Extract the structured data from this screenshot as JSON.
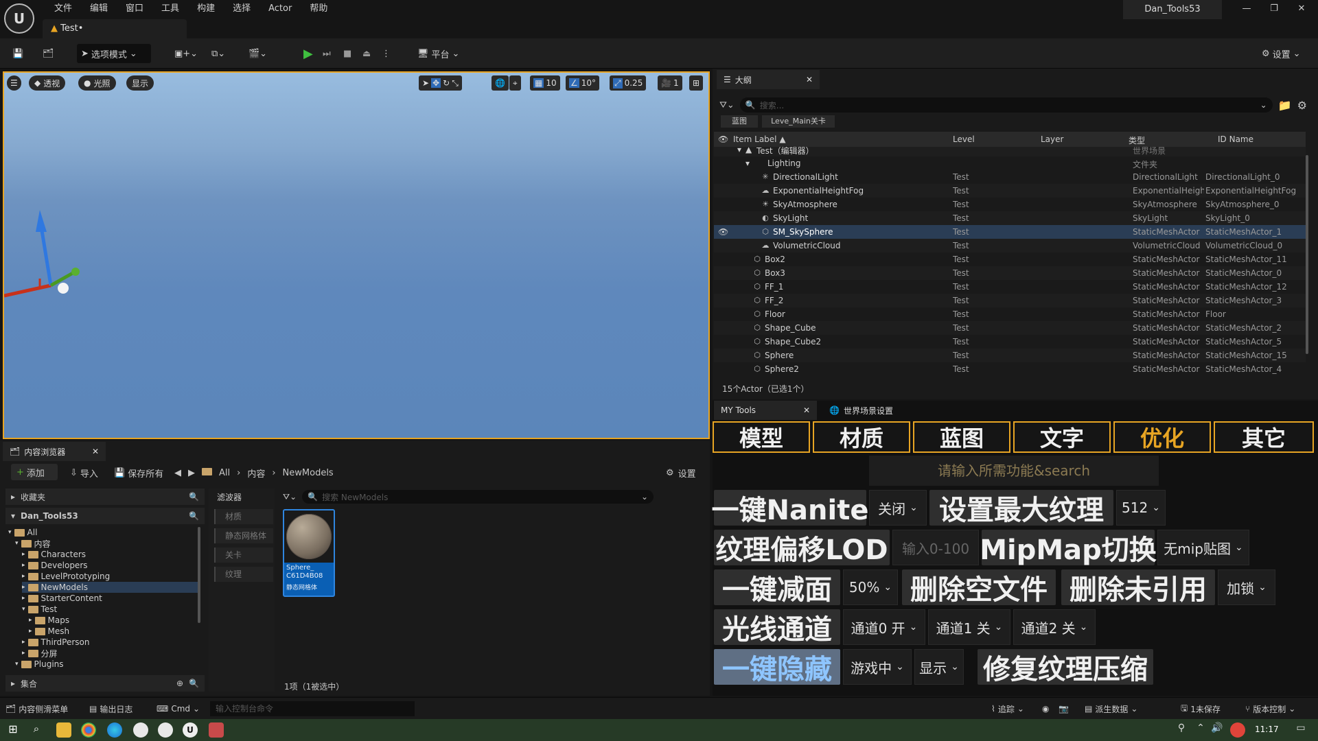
{
  "titlebar": {
    "menu": [
      "文件",
      "编辑",
      "窗口",
      "工具",
      "构建",
      "选择",
      "Actor",
      "帮助"
    ],
    "doc_tab": "Test•",
    "project": "Dan_Tools53"
  },
  "toolbar": {
    "mode": "选项模式",
    "platform": "平台",
    "settings": "设置"
  },
  "viewport": {
    "perspective": "透视",
    "lighting": "光照",
    "show": "显示",
    "grid_snap": "10",
    "rot_snap": "10°",
    "scale_snap": "0.25",
    "camera_speed": "1"
  },
  "outliner": {
    "tab": "大纲",
    "search_placeholder": "搜索...",
    "chips": [
      "蓝图",
      "Leve_Main关卡"
    ],
    "columns": [
      "Item Label ▲",
      "Level",
      "Layer",
      "类型",
      "ID Name"
    ],
    "root": {
      "label": "Test（编辑器）",
      "type": "世界场景"
    },
    "folder": {
      "label": "Lighting",
      "type": "文件夹"
    },
    "rows": [
      {
        "label": "DirectionalLight",
        "level": "Test",
        "type": "DirectionalLight",
        "id": "DirectionalLight_0",
        "icon": "directional-light-icon",
        "indent": 2
      },
      {
        "label": "ExponentialHeightFog",
        "level": "Test",
        "type": "ExponentialHeightFog",
        "id": "ExponentialHeightFog",
        "icon": "fog-icon",
        "indent": 2
      },
      {
        "label": "SkyAtmosphere",
        "level": "Test",
        "type": "SkyAtmosphere",
        "id": "SkyAtmosphere_0",
        "icon": "sky-atmosphere-icon",
        "indent": 2
      },
      {
        "label": "SkyLight",
        "level": "Test",
        "type": "SkyLight",
        "id": "SkyLight_0",
        "icon": "skylight-icon",
        "indent": 2
      },
      {
        "label": "SM_SkySphere",
        "level": "Test",
        "type": "StaticMeshActor",
        "id": "StaticMeshActor_1",
        "icon": "static-mesh-icon",
        "indent": 2,
        "selected": true
      },
      {
        "label": "VolumetricCloud",
        "level": "Test",
        "type": "VolumetricCloud",
        "id": "VolumetricCloud_0",
        "icon": "cloud-icon",
        "indent": 2
      },
      {
        "label": "Box2",
        "level": "Test",
        "type": "StaticMeshActor",
        "id": "StaticMeshActor_11",
        "icon": "static-mesh-icon",
        "indent": 1
      },
      {
        "label": "Box3",
        "level": "Test",
        "type": "StaticMeshActor",
        "id": "StaticMeshActor_0",
        "icon": "static-mesh-icon",
        "indent": 1
      },
      {
        "label": "FF_1",
        "level": "Test",
        "type": "StaticMeshActor",
        "id": "StaticMeshActor_12",
        "icon": "static-mesh-icon",
        "indent": 1
      },
      {
        "label": "FF_2",
        "level": "Test",
        "type": "StaticMeshActor",
        "id": "StaticMeshActor_3",
        "icon": "static-mesh-icon",
        "indent": 1
      },
      {
        "label": "Floor",
        "level": "Test",
        "type": "StaticMeshActor",
        "id": "Floor",
        "icon": "static-mesh-icon",
        "indent": 1
      },
      {
        "label": "Shape_Cube",
        "level": "Test",
        "type": "StaticMeshActor",
        "id": "StaticMeshActor_2",
        "icon": "static-mesh-icon",
        "indent": 1
      },
      {
        "label": "Shape_Cube2",
        "level": "Test",
        "type": "StaticMeshActor",
        "id": "StaticMeshActor_5",
        "icon": "static-mesh-icon",
        "indent": 1
      },
      {
        "label": "Sphere",
        "level": "Test",
        "type": "StaticMeshActor",
        "id": "StaticMeshActor_15",
        "icon": "static-mesh-icon",
        "indent": 1
      },
      {
        "label": "Sphere2",
        "level": "Test",
        "type": "StaticMeshActor",
        "id": "StaticMeshActor_4",
        "icon": "static-mesh-icon",
        "indent": 1
      }
    ],
    "footer": "15个Actor（已选1个）"
  },
  "mytools": {
    "tab": "MY Tools",
    "world_tab": "世界场景设置",
    "categories": [
      "模型",
      "材质",
      "蓝图",
      "文字",
      "优化",
      "其它"
    ],
    "search_placeholder": "请输入所需功能&search",
    "nanite": "一键Nanite",
    "nanite_opt": "关闭",
    "max_tex": "设置最大纹理",
    "max_tex_opt": "512",
    "tex_lod": "纹理偏移LOD",
    "tex_lod_input": "输入0-100",
    "mipmap": "MipMap切换",
    "mipmap_opt": "无mip贴图",
    "reduce": "一键减面",
    "reduce_opt": "50%",
    "del_empty": "删除空文件",
    "del_unref": "删除未引用",
    "lock_opt": "加锁",
    "light_ch": "光线通道",
    "ch0": "通道0 开",
    "ch1": "通道1 关",
    "ch2": "通道2 关",
    "hide": "一键隐藏",
    "hide_opt": "游戏中",
    "show_opt": "显示",
    "fix_tex": "修复纹理压缩"
  },
  "content_browser": {
    "tab": "内容浏览器",
    "add": "添加",
    "import": "导入",
    "save_all": "保存所有",
    "path": [
      "All",
      "内容",
      "NewModels"
    ],
    "settings": "设置",
    "favorites": "收藏夹",
    "project": "Dan_Tools53",
    "tree": [
      {
        "label": "All",
        "level": 0
      },
      {
        "label": "内容",
        "level": 1
      },
      {
        "label": "Characters",
        "level": 2
      },
      {
        "label": "Developers",
        "level": 2
      },
      {
        "label": "LevelPrototyping",
        "level": 2
      },
      {
        "label": "NewModels",
        "level": 2,
        "selected": true
      },
      {
        "label": "StarterContent",
        "level": 2
      },
      {
        "label": "Test",
        "level": 2
      },
      {
        "label": "Maps",
        "level": 3
      },
      {
        "label": "Mesh",
        "level": 3
      },
      {
        "label": "ThirdPerson",
        "level": 2
      },
      {
        "label": "分屏",
        "level": 2
      },
      {
        "label": "Plugins",
        "level": 1
      }
    ],
    "collections": "集合",
    "filters_title": "滤波器",
    "filters": [
      "材质",
      "静态网格体",
      "关卡",
      "纹理"
    ],
    "search_placeholder": "搜索 NewModels",
    "asset_name": "Sphere_\nC61D4B08",
    "asset_type": "静态网格体",
    "count": "1项（1被选中）"
  },
  "statusbar": {
    "drawer": "内容侧滑菜单",
    "output": "输出日志",
    "cmd": "Cmd",
    "console_placeholder": "输入控制台命令",
    "trace": "追踪",
    "derived": "派生数据",
    "unsaved": "1未保存",
    "source": "版本控制"
  },
  "taskbar": {
    "time": "11:17"
  }
}
